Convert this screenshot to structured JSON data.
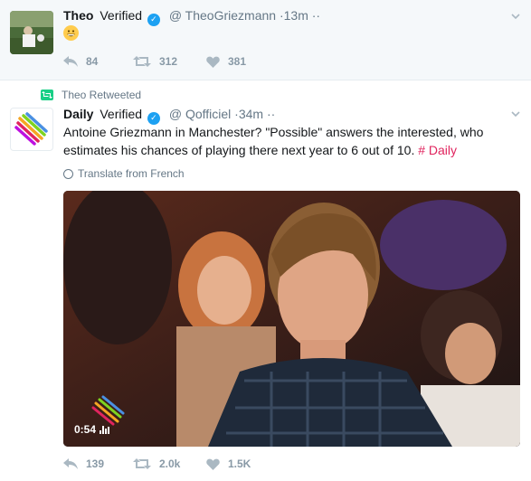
{
  "tweet1": {
    "name": "Theo",
    "verified_label": "Verified",
    "handle": "@ TheoGriezmann",
    "time": "·13m",
    "more": "··",
    "emoji": "grinning-face-emoji",
    "replies": "84",
    "retweets": "312",
    "likes": "381"
  },
  "tweet2": {
    "retweeted_by": "Theo Retweeted",
    "name": "Daily",
    "verified_label": "Verified",
    "handle": "@ Qofficiel",
    "time": "·34m",
    "more": "··",
    "text": "Antoine Griezmann in Manchester? \"Possible\" answers the interested, who estimates his chances of playing there next year to 6 out of 10.",
    "hashtag": "# Daily",
    "translate": "Translate from French",
    "video_duration": "0:54",
    "replies": "139",
    "retweets": "2.0k",
    "likes": "1.5K"
  },
  "colors": {
    "accent": "#1da1f2",
    "retweet": "#19cf86",
    "hashtag": "#e0245e",
    "muted": "#8899a6"
  }
}
